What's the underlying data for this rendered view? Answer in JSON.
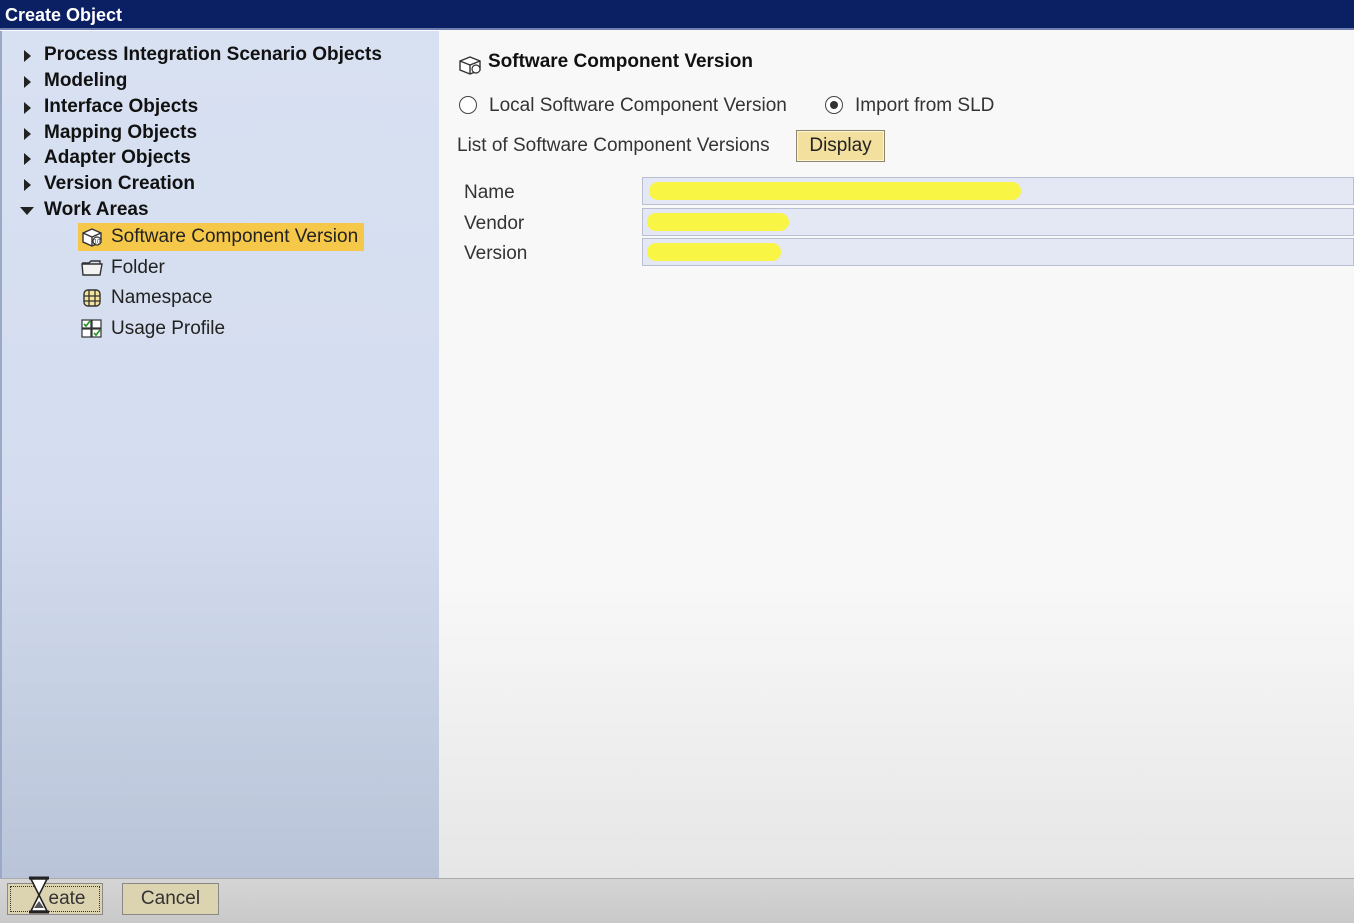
{
  "window": {
    "title": "Create Object"
  },
  "tree": {
    "categories": [
      {
        "label": "Process Integration Scenario Objects",
        "expanded": false
      },
      {
        "label": "Modeling",
        "expanded": false
      },
      {
        "label": "Interface Objects",
        "expanded": false
      },
      {
        "label": "Mapping Objects",
        "expanded": false
      },
      {
        "label": "Adapter Objects",
        "expanded": false
      },
      {
        "label": "Version Creation",
        "expanded": false
      },
      {
        "label": "Work Areas",
        "expanded": true
      }
    ],
    "work_area_items": [
      {
        "label": "Software Component Version",
        "icon": "software-component-icon",
        "selected": true
      },
      {
        "label": "Folder",
        "icon": "folder-icon",
        "selected": false
      },
      {
        "label": "Namespace",
        "icon": "namespace-icon",
        "selected": false
      },
      {
        "label": "Usage Profile",
        "icon": "usage-profile-icon",
        "selected": false
      }
    ]
  },
  "detail": {
    "title": "Software Component Version",
    "radio_options": [
      {
        "label": "Local Software Component Version",
        "selected": false
      },
      {
        "label": "Import from SLD",
        "selected": true
      }
    ],
    "list_label": "List of Software Component Versions",
    "display_button": "Display",
    "fields": [
      {
        "label": "Name",
        "value": "",
        "redacted": true
      },
      {
        "label": "Vendor",
        "value": "",
        "redacted": true
      },
      {
        "label": "Version",
        "value": "",
        "redacted": true
      }
    ]
  },
  "footer": {
    "create_label": "eate",
    "cancel_label": "Cancel"
  },
  "colors": {
    "titlebar": "#0b1f63",
    "selection": "#f6c84a",
    "button": "#f3df9e",
    "redaction": "#f9f53a"
  }
}
